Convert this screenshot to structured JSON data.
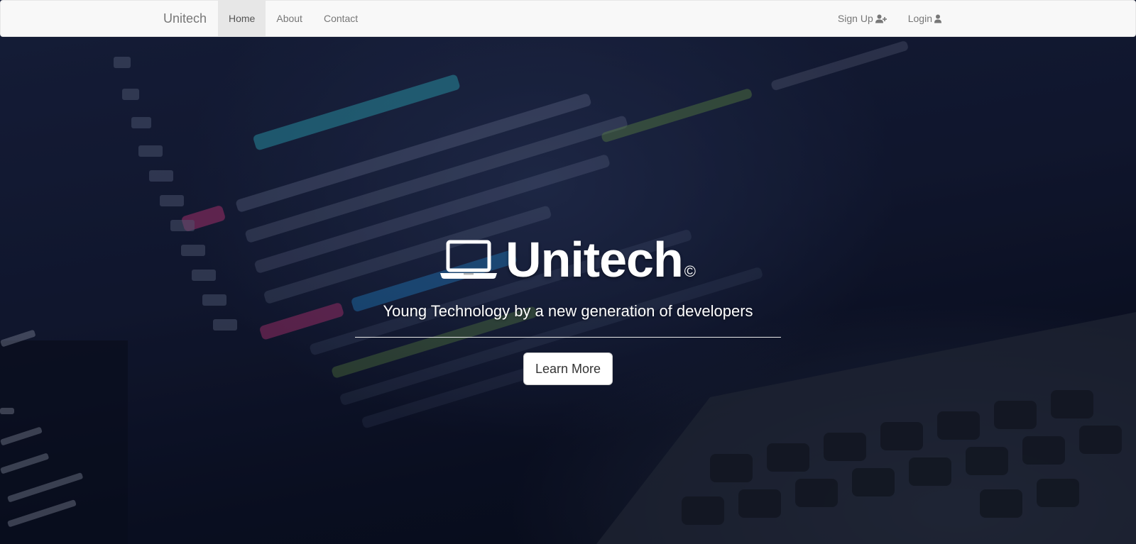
{
  "navbar": {
    "brand": "Unitech",
    "left_items": [
      {
        "label": "Home",
        "active": true
      },
      {
        "label": "About",
        "active": false
      },
      {
        "label": "Contact",
        "active": false
      }
    ],
    "right_items": [
      {
        "label": "Sign Up",
        "icon": "user-plus-icon"
      },
      {
        "label": "Login",
        "icon": "user-icon"
      }
    ]
  },
  "hero": {
    "icon": "laptop-icon",
    "title": "Unitech",
    "title_mark": "©",
    "subtitle": "Young Technology by a new generation of developers",
    "button_label": "Learn More"
  },
  "colors": {
    "navbar_bg": "#f8f8f8",
    "nav_text": "#777777",
    "active_bg": "#e7e7e7",
    "hero_text": "#ffffff",
    "button_bg": "#ffffff"
  }
}
